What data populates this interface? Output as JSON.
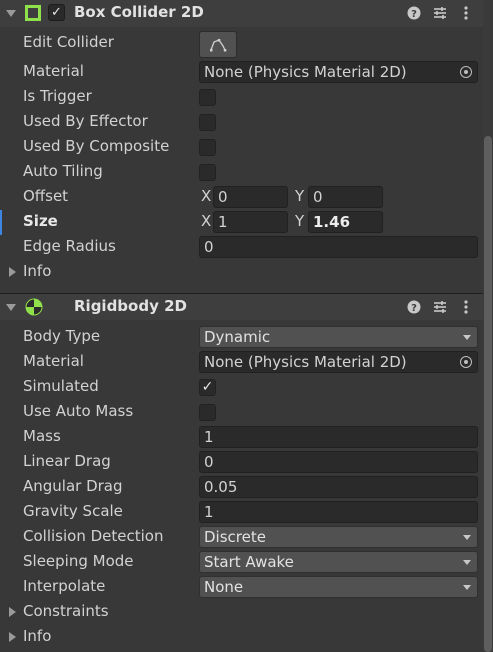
{
  "box_collider": {
    "title": "Box Collider 2D",
    "enabled_check": "✓",
    "icon": "box-collider-2d-icon",
    "header_buttons": [
      "help-icon",
      "preset-icon",
      "more-icon"
    ],
    "help_glyph": "?",
    "more_glyph": "⋮",
    "edit_collider_label": "Edit Collider",
    "material_label": "Material",
    "material_value": "None (Physics Material 2D)",
    "is_trigger_label": "Is Trigger",
    "used_by_effector_label": "Used By Effector",
    "used_by_composite_label": "Used By Composite",
    "auto_tiling_label": "Auto Tiling",
    "offset_label": "Offset",
    "offset_x_label": "X",
    "offset_x": "0",
    "offset_y_label": "Y",
    "offset_y": "0",
    "size_label": "Size",
    "size_x_label": "X",
    "size_x": "1",
    "size_y_label": "Y",
    "size_y": "1.46",
    "edge_radius_label": "Edge Radius",
    "edge_radius": "0",
    "info_label": "Info"
  },
  "rigidbody": {
    "title": "Rigidbody 2D",
    "icon": "rigidbody-2d-icon",
    "help_glyph": "?",
    "more_glyph": "⋮",
    "body_type_label": "Body Type",
    "body_type": "Dynamic",
    "material_label": "Material",
    "material_value": "None (Physics Material 2D)",
    "simulated_label": "Simulated",
    "simulated_check": "✓",
    "use_auto_mass_label": "Use Auto Mass",
    "mass_label": "Mass",
    "mass": "1",
    "linear_drag_label": "Linear Drag",
    "linear_drag": "0",
    "angular_drag_label": "Angular Drag",
    "angular_drag": "0.05",
    "gravity_scale_label": "Gravity Scale",
    "gravity_scale": "1",
    "collision_detection_label": "Collision Detection",
    "collision_detection": "Discrete",
    "sleeping_mode_label": "Sleeping Mode",
    "sleeping_mode": "Start Awake",
    "interpolate_label": "Interpolate",
    "interpolate": "None",
    "constraints_label": "Constraints",
    "info_label": "Info"
  },
  "colors": {
    "background": "#383838",
    "header": "#3e3e3e",
    "field": "#2a2a2a",
    "dropdown": "#515151",
    "collider_green": "#8fe04a",
    "selection_blue": "#3d85e0"
  }
}
